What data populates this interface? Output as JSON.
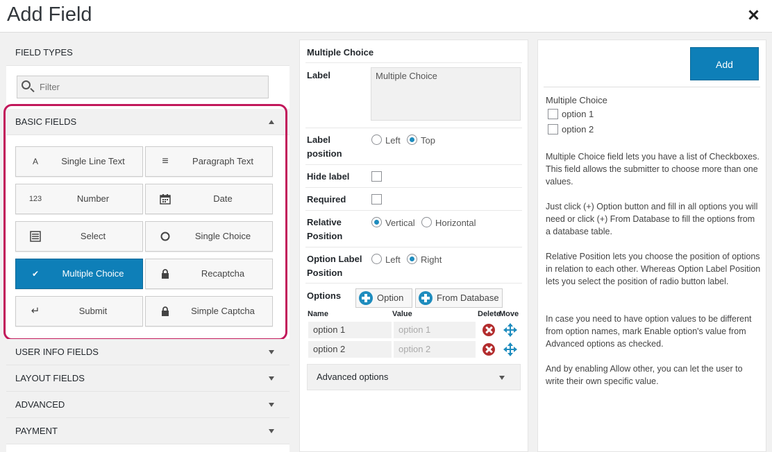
{
  "window": {
    "title": "Add Field"
  },
  "left": {
    "field_types_label": "FIELD TYPES",
    "filter_placeholder": "Filter",
    "basic_fields_label": "BASIC FIELDS",
    "fields": [
      {
        "label": "Single Line Text",
        "icon": "A"
      },
      {
        "label": "Paragraph Text",
        "icon": "≡"
      },
      {
        "label": "Number",
        "icon": "123"
      },
      {
        "label": "Date",
        "icon": "calendar"
      },
      {
        "label": "Select",
        "icon": "list"
      },
      {
        "label": "Single Choice",
        "icon": "○"
      },
      {
        "label": "Multiple Choice",
        "icon": "✔"
      },
      {
        "label": "Recaptcha",
        "icon": "lock"
      },
      {
        "label": "Submit",
        "icon": "↵"
      },
      {
        "label": "Simple Captcha",
        "icon": "lock"
      }
    ],
    "categories": [
      "USER INFO FIELDS",
      "LAYOUT FIELDS",
      "ADVANCED",
      "PAYMENT"
    ],
    "highlight_color": "#c2185b"
  },
  "middle": {
    "title": "Multiple Choice",
    "label_label": "Label",
    "label_value": "Multiple Choice",
    "label_position": {
      "line1": "Label",
      "line2": "position",
      "left": "Left",
      "top": "Top",
      "selected": "Top"
    },
    "hide_label": "Hide label",
    "required": "Required",
    "relative_position": {
      "line1": "Relative",
      "line2": "Position",
      "vertical": "Vertical",
      "horizontal": "Horizontal",
      "selected": "Vertical"
    },
    "option_label_position": {
      "line1": "Option Label",
      "line2": "Position",
      "left": "Left",
      "right": "Right",
      "selected": "Right"
    },
    "options_label": "Options",
    "option_btn": "Option",
    "from_db_btn": "From Database",
    "cols": {
      "name": "Name",
      "value": "Value",
      "delete": "Delete",
      "move": "Move"
    },
    "rows": [
      {
        "name": "option 1",
        "value_placeholder": "option 1"
      },
      {
        "name": "option 2",
        "value_placeholder": "option 2"
      }
    ],
    "advanced": "Advanced options"
  },
  "right": {
    "add_btn": "Add",
    "preview_title": "Multiple Choice",
    "preview_options": [
      "option 1",
      "option 2"
    ],
    "paragraphs": [
      "Multiple Choice field lets you have a list of Checkboxes. This field allows the submitter to choose more than one values.",
      "Just click (+) Option button and fill in all options you will need or click (+) From Database to fill the options from a database table.",
      "Relative Position lets you choose the position of options in relation to each other. Whereas Option Label Position lets you select the position of radio button label.",
      "In case you need to have option values to be different from option names, mark Enable option's value from Advanced options as checked.",
      "And by enabling Allow other, you can let the user to write their own specific value."
    ],
    "accent": "#0e7fb8"
  }
}
